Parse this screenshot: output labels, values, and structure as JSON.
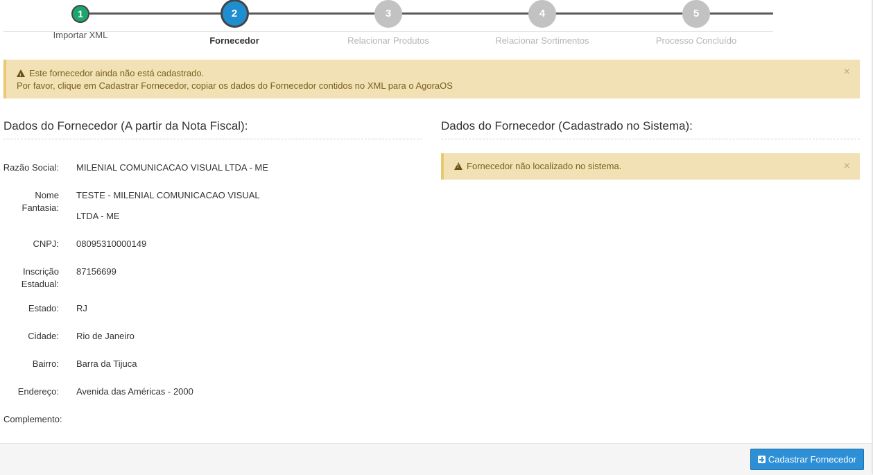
{
  "wizard": {
    "steps": [
      {
        "number": "1",
        "label": "Importar XML",
        "state": "done"
      },
      {
        "number": "2",
        "label": "Fornecedor",
        "state": "current"
      },
      {
        "number": "3",
        "label": "Relacionar Produtos",
        "state": "todo"
      },
      {
        "number": "4",
        "label": "Relacionar Sortimentos",
        "state": "todo"
      },
      {
        "number": "5",
        "label": "Processo Concluído",
        "state": "todo"
      }
    ]
  },
  "top_alert": {
    "line1": "Este fornecedor ainda não está cadastrado.",
    "line2": "Por favor, clique em Cadastrar Fornecedor, copiar os dados do Fornecedor contidos no XML para o AgoraOS",
    "close": "×"
  },
  "left_section": {
    "title": "Dados do Fornecedor (A partir da Nota Fiscal):",
    "fields": [
      {
        "label": "Razão Social:",
        "value": "MILENIAL COMUNICACAO VISUAL LTDA - ME"
      },
      {
        "label": "Nome Fantasia:",
        "value": "TESTE - MILENIAL COMUNICACAO VISUAL LTDA - ME"
      },
      {
        "label": "CNPJ:",
        "value": "08095310000149"
      },
      {
        "label": "Inscrição Estadual:",
        "value": "87156699"
      },
      {
        "label": "Estado:",
        "value": "RJ"
      },
      {
        "label": "Cidade:",
        "value": "Rio de Janeiro"
      },
      {
        "label": "Bairro:",
        "value": "Barra da Tijuca"
      },
      {
        "label": "Endereço:",
        "value": "Avenida das Américas - 2000"
      },
      {
        "label": "Complemento:",
        "value": ""
      }
    ]
  },
  "right_section": {
    "title": "Dados do Fornecedor (Cadastrado no Sistema):",
    "alert": "Fornecedor não localizado no sistema.",
    "close": "×"
  },
  "footer": {
    "register_button": "Cadastrar Fornecedor"
  },
  "colors": {
    "step_done": "#1ba56f",
    "step_current": "#1e8ecf",
    "step_todo": "#c2c2c2",
    "alert_bg": "#f1e1b4",
    "primary": "#2d8fd6"
  }
}
